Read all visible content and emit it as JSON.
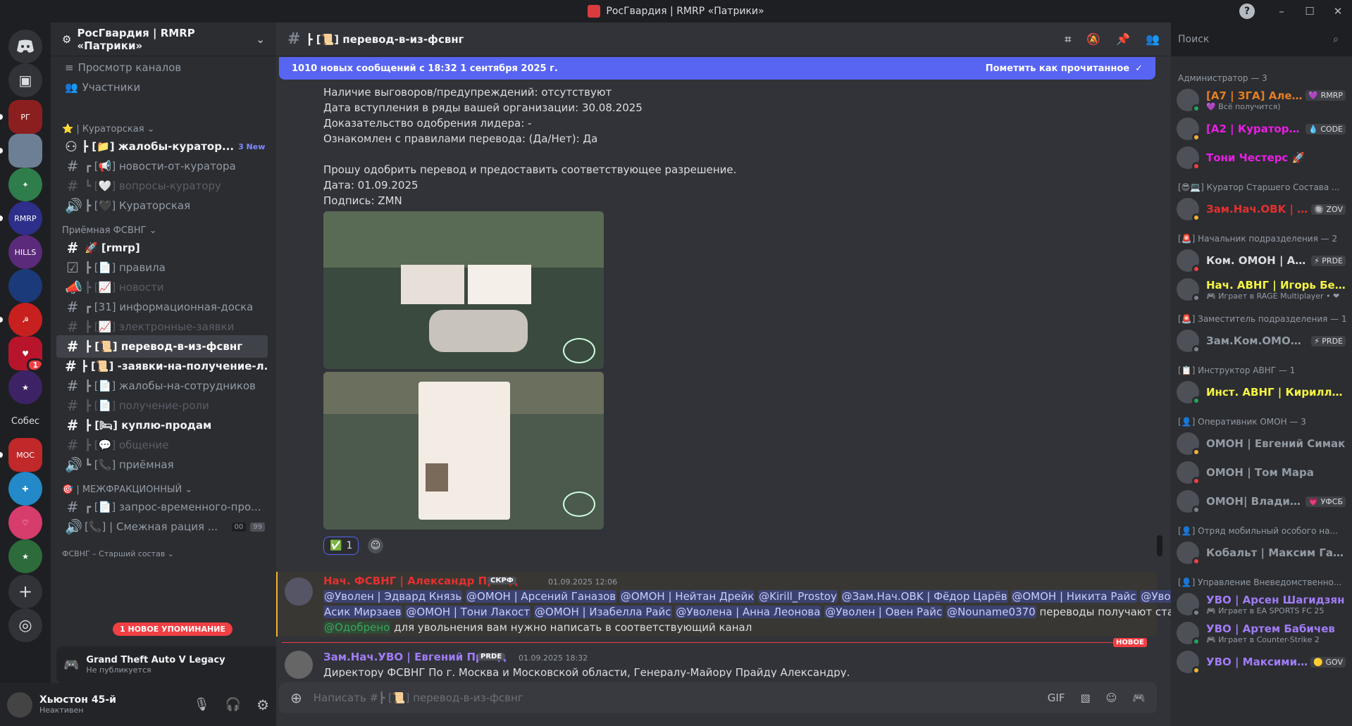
{
  "window": {
    "title": "РосГвардия | RMRP «Патрики»",
    "help": "?",
    "min": "–",
    "max": "☐",
    "close": "✕"
  },
  "guilds": {
    "items": [
      "◉",
      "▣",
      "",
      "",
      "",
      "",
      "",
      "",
      "",
      "",
      "",
      "",
      "",
      "",
      "Собес",
      "",
      "",
      "",
      "",
      "+",
      "◎"
    ],
    "badge": "1",
    "discord_icon": "discord-icon"
  },
  "server": {
    "name": "РосГвардия | RMRP «Патрики»",
    "chevron": "⌄"
  },
  "nav": {
    "browse": "Просмотр каналов",
    "members": "Участники"
  },
  "categories": {
    "curator": "⭐ | Кураторская ⌄",
    "reception": "Приёмная ФСВНГ ⌄",
    "interfaction": "🎯 | МЕЖФРАКЦИОННЫЙ ⌄",
    "fsvng": "ФСВНГ – Старший состав ⌄"
  },
  "channels": [
    {
      "name": "┣ [📁] жалобы-куратор...",
      "badge": "3 New"
    },
    {
      "name": "┏ [📢] новости-от-куратора"
    },
    {
      "name": "┗ [🤍] вопросы-куратору"
    },
    {
      "name": "┣ [🖤] Кураторская"
    },
    {
      "name": "🚀 [rmrp]"
    },
    {
      "name": "┣ [📄] правила"
    },
    {
      "name": "┣ [📈] новости"
    },
    {
      "name": "┏ [31] информационная-доска"
    },
    {
      "name": "┣ [📈] электронные-заявки"
    },
    {
      "name": "┣ [📜] перевод-в-из-фсвнг"
    },
    {
      "name": "┣ [📜] -заявки-на-получение-л..."
    },
    {
      "name": "┣ [📄] жалобы-на-сотрудников"
    },
    {
      "name": "┣ [📄] получение-роли"
    },
    {
      "name": "┣ [🛏] куплю-продам"
    },
    {
      "name": "┣ [💬] общение"
    },
    {
      "name": "┗ [📞] приёмная"
    },
    {
      "name": "┏ [📄] запрос-временного-про..."
    },
    {
      "name": "[📞] | Смежная рация ...",
      "counts": [
        "00",
        "99"
      ]
    }
  ],
  "mention_pill": "1 НОВОЕ УПОМИНАНИЕ",
  "activity": {
    "game": "Grand Theft Auto V Legacy",
    "status": "Не публикуется"
  },
  "user": {
    "name": "Хьюстон 45-й",
    "status": "Неактивен"
  },
  "channel_header": {
    "hash": "#",
    "name": "┣ [📜] перевод-в-из-фсвнг"
  },
  "search": {
    "placeholder": "Поиск"
  },
  "banner": {
    "text": "1010 новых сообщений с 18:32 1 сентября 2025 г.",
    "action": "Пометить как прочитанное"
  },
  "message1_lines": [
    "Наличие выговоров/предупреждений: отсутствуют",
    "Дата вступления в ряды вашей организации: 30.08.2025",
    "Доказательство одобрения лидера: -",
    "Ознакомлен с правилами перевода: (Да/Нет): Да",
    "",
    "Прошу одобрить перевод и предоставить соответствующее разрешение.",
    "Дата: 01.09.2025",
    "Подпись: ZMN"
  ],
  "reaction": {
    "emoji": "✅",
    "count": "1"
  },
  "message2": {
    "author": "Нач. ФСВНГ | Александр Прайд",
    "tag": "СКРФ",
    "time": "01.09.2025 12:06",
    "line1_mentions": [
      "@Уволен | Эдвард Князь",
      "@ОМОН | Арсений Ганазов",
      "@ОМОН | Нейтан Дрейк",
      "@Kirill_Prostoy",
      "@Зам.Нач.OBK | Фёдор Царёв",
      "@ОМОН | Никита Райс",
      "@Уволен |"
    ],
    "line2_mentions": [
      "Асик Мирзаев",
      "@ОМОН | Тони Лакост",
      "@ОМОН | Изабелла Райс",
      "@Уволена | Анна Леонова",
      "@Уволен | Овен Райс",
      "@Nouname0370"
    ],
    "line2_tail": "переводы получают статус",
    "line3_mention": "@Одобрено",
    "line3_tail": "для увольнения вам нужно написать в соответствующий канал"
  },
  "new_marker": "НОВОЕ",
  "message3": {
    "author": "Зам.Нач.УВО | Евгений Прайд",
    "tag": "PRDE",
    "time": "01.09.2025 18:32",
    "text": "Директору ФСВНГ По г. Москва и Московской области, Генералу-Майору Прайду Александру."
  },
  "composer": {
    "placeholder": "Написать #┣ [📜] перевод-в-из-фсвнг"
  },
  "member_groups": [
    {
      "header": "Администратор — 3",
      "members": [
        {
          "name": "[A7 | ЗГА] Алекс...",
          "tag": "💜 RMRP",
          "sub": "💜 Всё получится)",
          "color": "#e67e22"
        },
        {
          "name": "[A2 | Куратор] К...",
          "tag": "💧 CODE",
          "sub": "",
          "color": "#e91ee3"
        },
        {
          "name": "Тони Честерс 🚀",
          "tag": "",
          "sub": "",
          "color": "#e91ee3"
        }
      ]
    },
    {
      "header": "[😎💻] Куратор Старшего Состава ...",
      "members": [
        {
          "name": "Зам.Нач.OBK | Фё...",
          "tag": "🔘 ZOV",
          "sub": "",
          "color": "#e33030"
        }
      ]
    },
    {
      "header": "[🚨] Начальник подразделения — 2",
      "members": [
        {
          "name": "Ком. ОМОН | Ар...",
          "tag": "⚡ PRDE",
          "sub": "",
          "color": "#dbdee1"
        },
        {
          "name": "Нач. АВНГ | Игорь Бели...",
          "tag": "",
          "sub": "🎮 Играет в RAGE Multiplayer • ❤",
          "color": "#f5f542"
        }
      ]
    },
    {
      "header": "[🚨] Заместитель подразделения — 1",
      "members": [
        {
          "name": "Зам.Ком.ОМОН |...",
          "tag": "⚡ PRDE",
          "sub": "",
          "color": "#949ba4"
        }
      ]
    },
    {
      "header": "[📋] Инструктор АВНГ — 1",
      "members": [
        {
          "name": "Инст. АВНГ | Кирилл Са...",
          "tag": "",
          "sub": "",
          "color": "#f5f542"
        }
      ]
    },
    {
      "header": "[👤] Оперативник ОМОН — 3",
      "members": [
        {
          "name": "ОМОН | Евгений Симак",
          "tag": "",
          "sub": "",
          "color": "#949ba4"
        },
        {
          "name": "ОМОН | Том Мара",
          "tag": "",
          "sub": "",
          "color": "#949ba4"
        },
        {
          "name": "ОМОН| Владисл...",
          "tag": "💗 УФСБ",
          "sub": "",
          "color": "#949ba4"
        }
      ]
    },
    {
      "header": "[👤] Отряд мобильный особого на...",
      "members": [
        {
          "name": "Кобальт | Максим Ганазов",
          "tag": "",
          "sub": "",
          "color": "#949ba4"
        }
      ]
    },
    {
      "header": "[👤] Управление Вневедомственно...",
      "members": [
        {
          "name": "УВО | Арсен Шагидзян",
          "tag": "",
          "sub": "🎮 Играет в EA SPORTS FC 25",
          "color": "#a07cf5"
        },
        {
          "name": "УВО | Артем Бабичев",
          "tag": "",
          "sub": "🎮 Играет в Counter-Strike 2",
          "color": "#a07cf5"
        },
        {
          "name": "УВО | Максимили...",
          "tag": "🟡 GOV",
          "sub": "",
          "color": "#a07cf5"
        }
      ]
    }
  ]
}
